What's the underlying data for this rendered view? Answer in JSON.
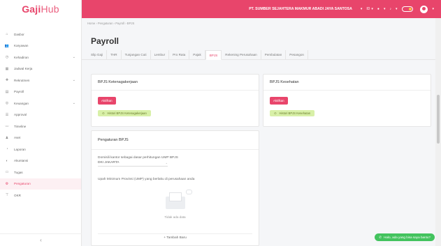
{
  "brand": {
    "part1": "Gaji",
    "part2": "Hub"
  },
  "header": {
    "company": "PT. SUMBER SEJAHTERA MAKMUR ABADI JAYA SANTOSA",
    "lang": "ID",
    "chev": "▾"
  },
  "sidebar": {
    "items": [
      {
        "label": "Dasbor",
        "icon": "⌂",
        "icon_name": "home-icon",
        "chev": ""
      },
      {
        "label": "Karyawan",
        "icon": "👥",
        "icon_name": "users-icon",
        "chev": ""
      },
      {
        "label": "Kehadiran",
        "icon": "◷",
        "icon_name": "clock-icon",
        "chev": "⌄"
      },
      {
        "label": "Jadwal Kerja",
        "icon": "▦",
        "icon_name": "calendar-icon",
        "chev": ""
      },
      {
        "label": "Rekrutmen",
        "icon": "✚",
        "icon_name": "recruit-icon",
        "chev": "⌄"
      },
      {
        "label": "Payroll",
        "icon": "▤",
        "icon_name": "payroll-icon",
        "chev": ""
      },
      {
        "label": "Keuangan",
        "icon": "◎",
        "icon_name": "finance-icon",
        "chev": "⌄"
      },
      {
        "label": "Approval",
        "icon": "☰",
        "icon_name": "approval-icon",
        "chev": ""
      },
      {
        "label": "Timeline",
        "icon": "〰",
        "icon_name": "timeline-icon",
        "chev": ""
      },
      {
        "label": "Aset",
        "icon": "♟",
        "icon_name": "asset-icon",
        "chev": ""
      },
      {
        "label": "Laporan",
        "icon": "◔",
        "icon_name": "report-icon",
        "chev": ""
      },
      {
        "label": "Akuntansi",
        "icon": "◐",
        "icon_name": "accounting-icon",
        "chev": ""
      },
      {
        "label": "Tugas",
        "icon": "▭",
        "icon_name": "task-icon",
        "chev": ""
      },
      {
        "label": "Pengaturan",
        "icon": "⚙",
        "icon_name": "gear-icon",
        "chev": "",
        "active": true
      },
      {
        "label": "OKR",
        "icon": "⊤",
        "icon_name": "okr-icon",
        "chev": ""
      }
    ],
    "collapse": "‹"
  },
  "breadcrumb": "Home  ›  Pengaturan  ›  Payroll  ›  BPJS",
  "page_title": "Payroll",
  "tabs": [
    "Slip Gaji",
    "THR",
    "Tunjangan Cuti",
    "Lembur",
    "Pro Rata",
    "Pajak",
    "BPJS",
    "Rekening Perusahaan",
    "Pembulatan",
    "Pesangon"
  ],
  "active_tab": "BPJS",
  "bpjs_tk": {
    "title": "BPJS Ketenagakerjaan",
    "activate": "Aktifkan",
    "history": "Histori BPJS Ketenagakerjaan"
  },
  "bpjs_kes": {
    "title": "BPJS Kesehatan",
    "activate": "Aktifkan",
    "history": "Histori BPJS Kesehatan"
  },
  "settings": {
    "title": "Pengaturan BPJS",
    "domicile_label": "Domisili kantor sebagai dasar perhitungan UMP BPJS",
    "domicile_value": "DKI JAKARTA",
    "ump_label": "Upah Minimum Provinsi (UMP) yang berlaku di perusahaan anda",
    "empty_text": "Tidak ada data",
    "add_button": "+  Tambah Baru"
  },
  "chat_button": "Halo, ada yang bisa saya bantu?",
  "colors": {
    "primary": "#e8456b",
    "green": "#d8f0a8",
    "chat": "#43c35e"
  }
}
